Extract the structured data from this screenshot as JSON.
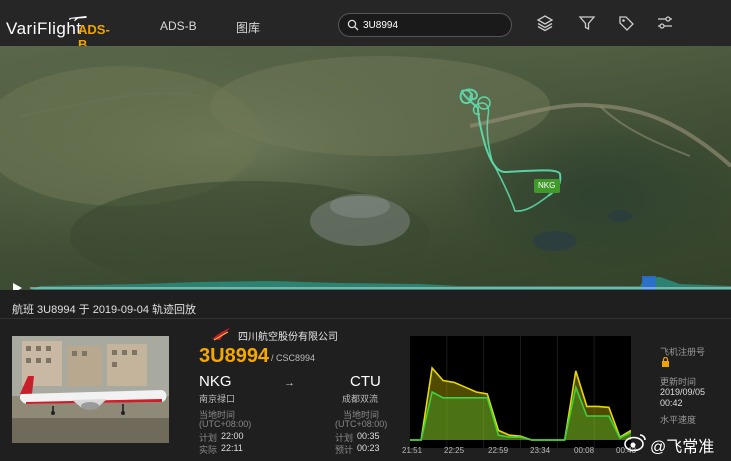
{
  "header": {
    "logo_text": "VariFlight",
    "logo_sub": "ADS-B",
    "nav": [
      "ADS-B",
      "图库"
    ],
    "search_value": "3U8994"
  },
  "map": {
    "airport_label": "NKG"
  },
  "panel": {
    "title": "航班 3U8994 于 2019-09-04 轨迹回放",
    "airline_name": "四川航空股份有限公司",
    "flight_no": "3U8994",
    "callsign": "/ CSC8994",
    "origin": {
      "code": "NKG",
      "name": "南京禄口",
      "local_time_label": "当地时间",
      "tz": "(UTC+08:00)",
      "sched_label": "计划",
      "sched_time": "22:00",
      "actual_label": "实际",
      "actual_time": "22:11"
    },
    "arrow": "→",
    "destination": {
      "code": "CTU",
      "name": "成都双流",
      "local_time_label": "当地时间",
      "tz": "(UTC+08:00)",
      "sched_label": "计划",
      "sched_time": "00:35",
      "est_label": "预计",
      "est_time": "00:23"
    },
    "side": {
      "reg_label": "飞机注册号",
      "updated_label": "更新时间",
      "updated_date": "2019/09/05",
      "updated_time": "00:42",
      "speed_label": "水平速度"
    }
  },
  "chart_data": {
    "type": "line",
    "x_ticks": [
      "21:51",
      "22:25",
      "22:59",
      "23:34",
      "00:08",
      "00:43"
    ],
    "series": [
      {
        "color": "#e8d800",
        "values": [
          0,
          0,
          0.75,
          0.62,
          0.6,
          0.55,
          0.5,
          0.48,
          0.1,
          0.05,
          0.04,
          0,
          0,
          0,
          0,
          0.72,
          0.35,
          0.35,
          0.34,
          0.03,
          0.1
        ]
      },
      {
        "color": "#3ed23e",
        "values": [
          0,
          0,
          0.5,
          0.44,
          0.44,
          0.44,
          0.44,
          0.44,
          0.05,
          0.03,
          0.03,
          0,
          0,
          0,
          0,
          0.55,
          0.25,
          0.25,
          0.25,
          0.02,
          0.08
        ]
      }
    ]
  },
  "watermark": {
    "text": "@飞常准"
  },
  "colors": {
    "accent": "#f5a800",
    "track": "#5ee0b0",
    "marker": "#3f9a2a"
  }
}
